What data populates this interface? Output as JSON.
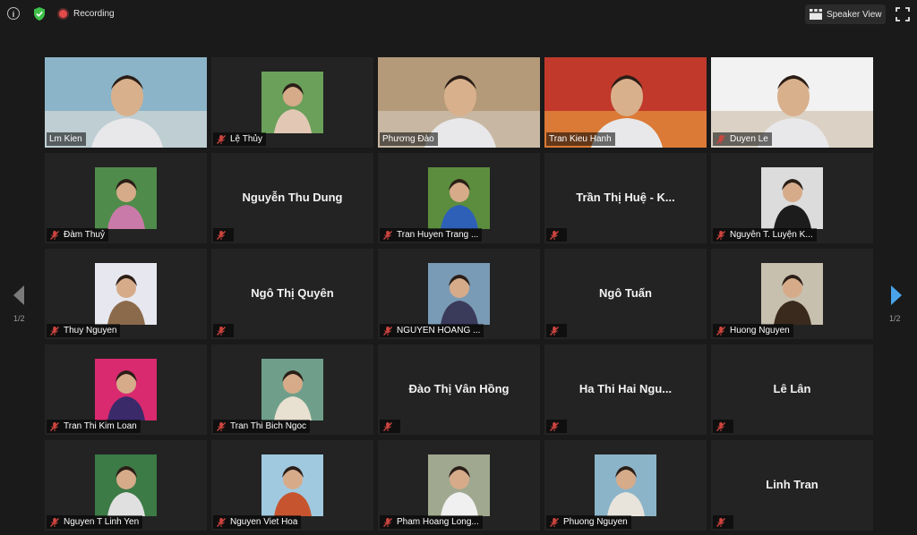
{
  "toolbar": {
    "info_glyph": "i",
    "recording_label": "Recording",
    "speaker_view_label": "Speaker View"
  },
  "pagination": {
    "left": "1/2",
    "right": "1/2"
  },
  "colors": {
    "active_speaker_border": "#c7e36b",
    "recording": "#e34b4b",
    "muted_mic": "#d0453f",
    "shield": "#3fbf4a",
    "nav_next": "#4aa3e8"
  },
  "participants": [
    {
      "name": "Lm Kien",
      "kind": "video",
      "muted": false,
      "active": true
    },
    {
      "name": "Lệ Thủy",
      "kind": "photo",
      "muted": true
    },
    {
      "name": "Phương Đào",
      "kind": "video",
      "muted": false
    },
    {
      "name": "Tran Kieu Hanh",
      "kind": "video",
      "muted": false
    },
    {
      "name": "Duyen Le",
      "kind": "video",
      "muted": true
    },
    {
      "name": "Đàm Thuỷ",
      "kind": "photo",
      "muted": true
    },
    {
      "name": "Nguyễn Thu Dung",
      "kind": "name",
      "muted": true
    },
    {
      "name": "Tran Huyen Trang ...",
      "kind": "photo",
      "muted": true
    },
    {
      "name": "Trần Thị Huệ - K...",
      "kind": "name",
      "muted": true
    },
    {
      "name": "Nguyễn T. Luyện K...",
      "kind": "photo",
      "muted": true
    },
    {
      "name": "Thuy Nguyen",
      "kind": "photo",
      "muted": true
    },
    {
      "name": "Ngô Thị Quyên",
      "kind": "name",
      "muted": true
    },
    {
      "name": "NGUYEN HOANG ...",
      "kind": "photo",
      "muted": true
    },
    {
      "name": "Ngô Tuấn",
      "kind": "name",
      "muted": true
    },
    {
      "name": "Huong Nguyen",
      "kind": "photo",
      "muted": true
    },
    {
      "name": "Tran Thi Kim Loan",
      "kind": "photo",
      "muted": true
    },
    {
      "name": "Tran Thi Bich Ngoc",
      "kind": "photo",
      "muted": true
    },
    {
      "name": "Đào Thị Vân Hồng",
      "kind": "name",
      "muted": true
    },
    {
      "name": "Ha Thi Hai Ngu...",
      "kind": "name",
      "muted": true
    },
    {
      "name": "Lê Lân",
      "kind": "name",
      "muted": true
    },
    {
      "name": "Nguyen T Linh Yen",
      "kind": "photo",
      "muted": true
    },
    {
      "name": "Nguyen Viet Hoa",
      "kind": "photo",
      "muted": true
    },
    {
      "name": "Pham Hoang Long...",
      "kind": "photo",
      "muted": true
    },
    {
      "name": "Phuong Nguyen",
      "kind": "photo",
      "muted": true
    },
    {
      "name": "Linh Tran",
      "kind": "name",
      "muted": true
    }
  ]
}
